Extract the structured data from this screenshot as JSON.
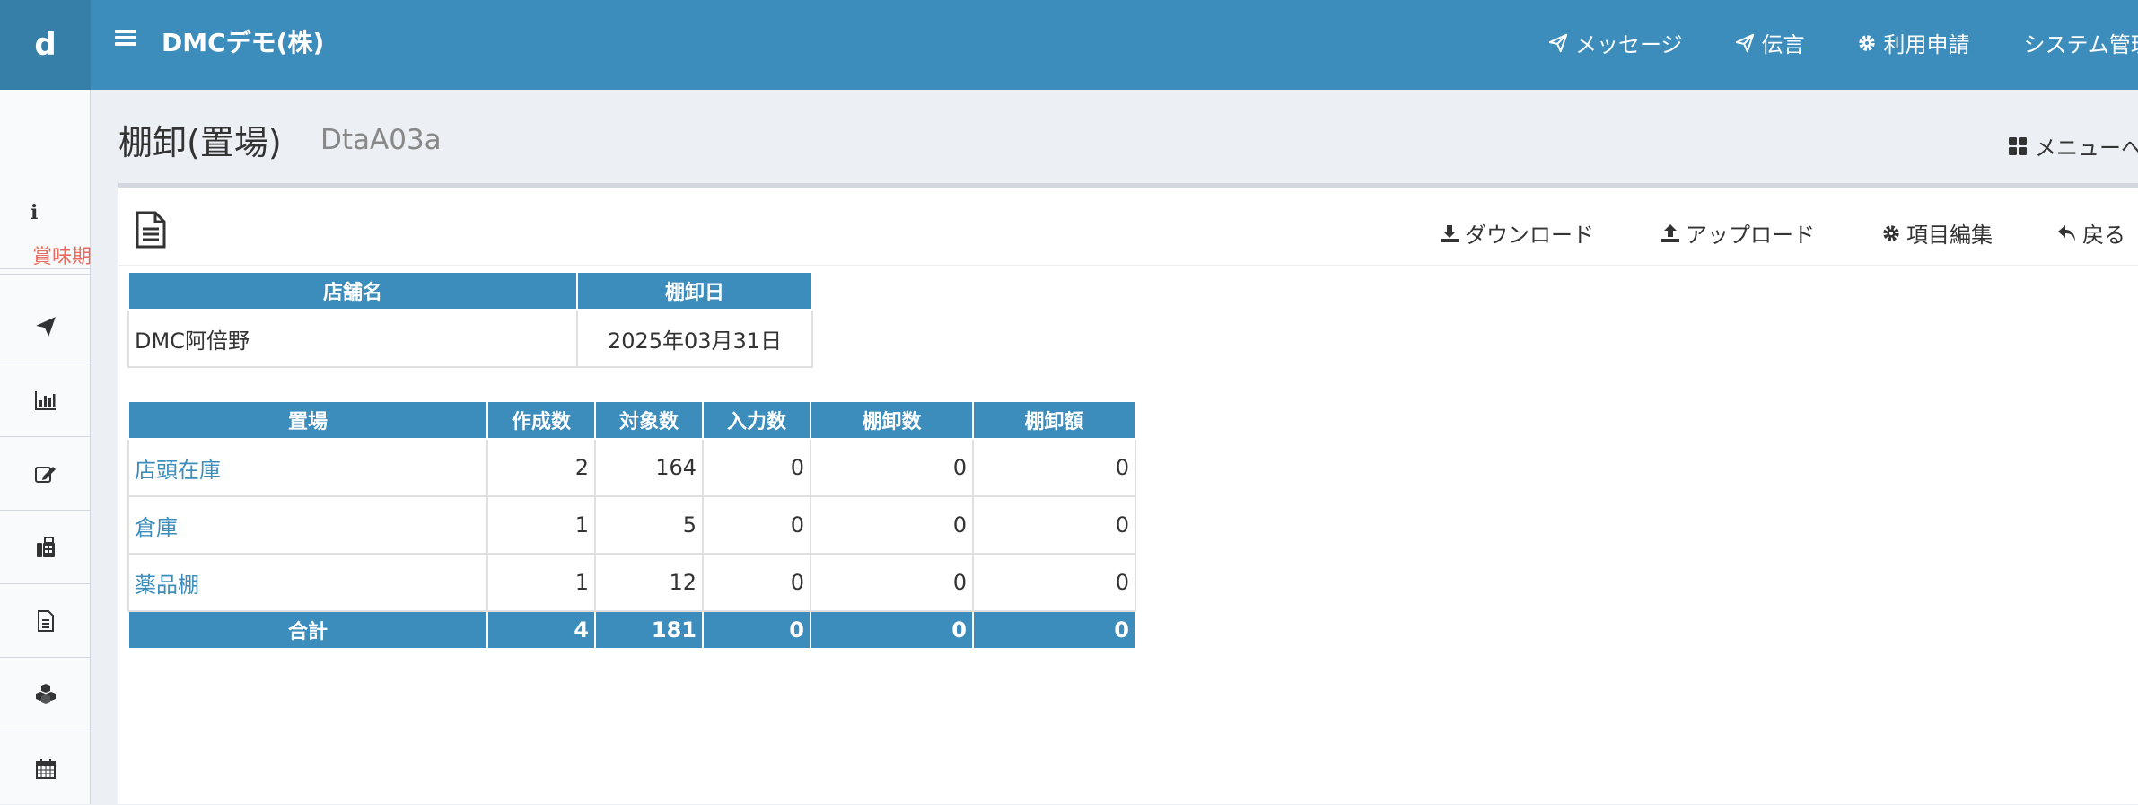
{
  "app": {
    "logo": "d",
    "company": "DMCデモ(株)"
  },
  "topnav": [
    {
      "label": "メッセージ",
      "icon": "send-icon"
    },
    {
      "label": "伝言",
      "icon": "send-icon"
    },
    {
      "label": "利用申請",
      "icon": "gear-icon"
    },
    {
      "label": "システム管理",
      "icon": ""
    }
  ],
  "sidebar": {
    "info_icon": "i",
    "expiry_label": "賞味期",
    "items": [
      "send-icon",
      "bar-chart-icon",
      "edit-icon",
      "fax-icon",
      "document-icon",
      "cubes-icon",
      "calendar-icon"
    ]
  },
  "page": {
    "title": "棚卸(置場)",
    "code": "DtaA03a",
    "menu_link": "メニューへ"
  },
  "toolbar": {
    "download": "ダウンロード",
    "upload": "アップロード",
    "edit_items": "項目編集",
    "back": "戻る"
  },
  "store_table": {
    "headers": [
      "店舗名",
      "棚卸日"
    ],
    "store": "DMC阿倍野",
    "date": "2025年03月31日"
  },
  "location_table": {
    "headers": [
      "置場",
      "作成数",
      "対象数",
      "入力数",
      "棚卸数",
      "棚卸額"
    ],
    "rows": [
      {
        "location": "店頭在庫",
        "created": "2",
        "target": "164",
        "input": "0",
        "counted": "0",
        "amount": "0"
      },
      {
        "location": "倉庫",
        "created": "1",
        "target": "5",
        "input": "0",
        "counted": "0",
        "amount": "0"
      },
      {
        "location": "薬品棚",
        "created": "1",
        "target": "12",
        "input": "0",
        "counted": "0",
        "amount": "0"
      }
    ],
    "total": {
      "label": "合計",
      "created": "4",
      "target": "181",
      "input": "0",
      "counted": "0",
      "amount": "0"
    }
  }
}
